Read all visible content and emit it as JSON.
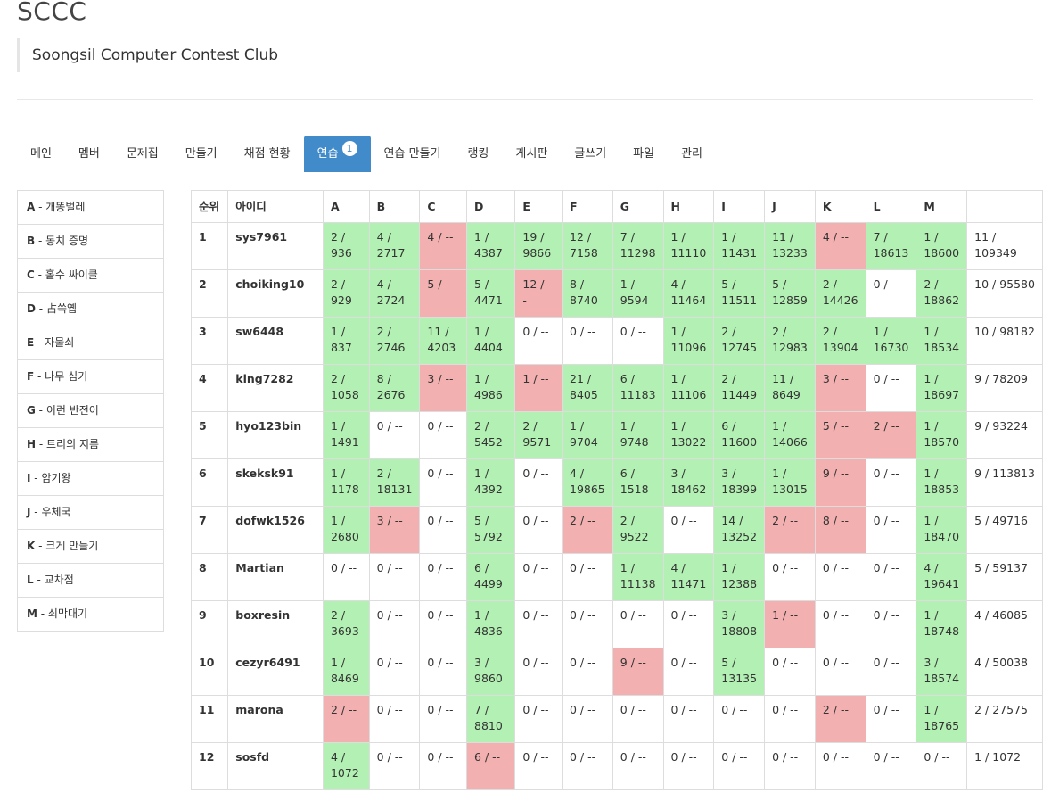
{
  "site": {
    "title": "SCCC",
    "subtitle": "Soongsil Computer Contest Club"
  },
  "nav": {
    "items": [
      "메인",
      "멤버",
      "문제집",
      "만들기",
      "채점 현황",
      "연습",
      "연습 만들기",
      "랭킹",
      "게시판",
      "글쓰기",
      "파일",
      "관리"
    ],
    "active_index": 5,
    "badge": "1"
  },
  "problems": [
    {
      "code": "A",
      "name": "개똥벌레"
    },
    {
      "code": "B",
      "name": "동치 증명"
    },
    {
      "code": "C",
      "name": "홀수 싸이클"
    },
    {
      "code": "D",
      "name": "占쏙옙"
    },
    {
      "code": "E",
      "name": "자물쇠"
    },
    {
      "code": "F",
      "name": "나무 심기"
    },
    {
      "code": "G",
      "name": "이런 반전이"
    },
    {
      "code": "H",
      "name": "트리의 지름"
    },
    {
      "code": "I",
      "name": "암기왕"
    },
    {
      "code": "J",
      "name": "우체국"
    },
    {
      "code": "K",
      "name": "크게 만들기"
    },
    {
      "code": "L",
      "name": "교차점"
    },
    {
      "code": "M",
      "name": "쇠막대기"
    }
  ],
  "table": {
    "headers": {
      "rank": "순위",
      "id": "아이디",
      "total": ""
    },
    "rows": [
      {
        "rank": "1",
        "id": "sys7961",
        "total": "11 / 109349",
        "cells": [
          {
            "t": "2 / 936",
            "s": "ok"
          },
          {
            "t": "4 / 2717",
            "s": "ok"
          },
          {
            "t": "4 / --",
            "s": "bad"
          },
          {
            "t": "1 / 4387",
            "s": "ok"
          },
          {
            "t": "19 / 9866",
            "s": "ok"
          },
          {
            "t": "12 / 7158",
            "s": "ok"
          },
          {
            "t": "7 / 11298",
            "s": "ok"
          },
          {
            "t": "1 / 11110",
            "s": "ok"
          },
          {
            "t": "1 / 11431",
            "s": "ok"
          },
          {
            "t": "11 / 13233",
            "s": "ok"
          },
          {
            "t": "4 / --",
            "s": "bad"
          },
          {
            "t": "7 / 18613",
            "s": "ok"
          },
          {
            "t": "1 / 18600",
            "s": "ok"
          }
        ]
      },
      {
        "rank": "2",
        "id": "choiking10",
        "total": "10 / 95580",
        "cells": [
          {
            "t": "2 / 929",
            "s": "ok"
          },
          {
            "t": "4 / 2724",
            "s": "ok"
          },
          {
            "t": "5 / --",
            "s": "bad"
          },
          {
            "t": "5 / 4471",
            "s": "ok"
          },
          {
            "t": "12 / --",
            "s": "bad"
          },
          {
            "t": "8 / 8740",
            "s": "ok"
          },
          {
            "t": "1 / 9594",
            "s": "ok"
          },
          {
            "t": "4 / 11464",
            "s": "ok"
          },
          {
            "t": "5 / 11511",
            "s": "ok"
          },
          {
            "t": "5 / 12859",
            "s": "ok"
          },
          {
            "t": "2 / 14426",
            "s": "ok"
          },
          {
            "t": "0 / --",
            "s": "none"
          },
          {
            "t": "2 / 18862",
            "s": "ok"
          }
        ]
      },
      {
        "rank": "3",
        "id": "sw6448",
        "total": "10 / 98182",
        "cells": [
          {
            "t": "1 / 837",
            "s": "ok"
          },
          {
            "t": "2 / 2746",
            "s": "ok"
          },
          {
            "t": "11 / 4203",
            "s": "ok"
          },
          {
            "t": "1 / 4404",
            "s": "ok"
          },
          {
            "t": "0 / --",
            "s": "none"
          },
          {
            "t": "0 / --",
            "s": "none"
          },
          {
            "t": "0 / --",
            "s": "none"
          },
          {
            "t": "1 / 11096",
            "s": "ok"
          },
          {
            "t": "2 / 12745",
            "s": "ok"
          },
          {
            "t": "2 / 12983",
            "s": "ok"
          },
          {
            "t": "2 / 13904",
            "s": "ok"
          },
          {
            "t": "1 / 16730",
            "s": "ok"
          },
          {
            "t": "1 / 18534",
            "s": "ok"
          }
        ]
      },
      {
        "rank": "4",
        "id": "king7282",
        "total": "9 / 78209",
        "cells": [
          {
            "t": "2 / 1058",
            "s": "ok"
          },
          {
            "t": "8 / 2676",
            "s": "ok"
          },
          {
            "t": "3 / --",
            "s": "bad"
          },
          {
            "t": "1 / 4986",
            "s": "ok"
          },
          {
            "t": "1 / --",
            "s": "bad"
          },
          {
            "t": "21 / 8405",
            "s": "ok"
          },
          {
            "t": "6 / 11183",
            "s": "ok"
          },
          {
            "t": "1 / 11106",
            "s": "ok"
          },
          {
            "t": "2 / 11449",
            "s": "ok"
          },
          {
            "t": "11 / 8649",
            "s": "ok"
          },
          {
            "t": "3 / --",
            "s": "bad"
          },
          {
            "t": "0 / --",
            "s": "none"
          },
          {
            "t": "1 / 18697",
            "s": "ok"
          }
        ]
      },
      {
        "rank": "5",
        "id": "hyo123bin",
        "total": "9 / 93224",
        "cells": [
          {
            "t": "1 / 1491",
            "s": "ok"
          },
          {
            "t": "0 / --",
            "s": "none"
          },
          {
            "t": "0 / --",
            "s": "none"
          },
          {
            "t": "2 / 5452",
            "s": "ok"
          },
          {
            "t": "2 / 9571",
            "s": "ok"
          },
          {
            "t": "1 / 9704",
            "s": "ok"
          },
          {
            "t": "1 / 9748",
            "s": "ok"
          },
          {
            "t": "1 / 13022",
            "s": "ok"
          },
          {
            "t": "6 / 11600",
            "s": "ok"
          },
          {
            "t": "1 / 14066",
            "s": "ok"
          },
          {
            "t": "5 / --",
            "s": "bad"
          },
          {
            "t": "2 / --",
            "s": "bad"
          },
          {
            "t": "1 / 18570",
            "s": "ok"
          }
        ]
      },
      {
        "rank": "6",
        "id": "skeksk91",
        "total": "9 / 113813",
        "cells": [
          {
            "t": "1 / 1178",
            "s": "ok"
          },
          {
            "t": "2 / 18131",
            "s": "ok"
          },
          {
            "t": "0 / --",
            "s": "none"
          },
          {
            "t": "1 / 4392",
            "s": "ok"
          },
          {
            "t": "0 / --",
            "s": "none"
          },
          {
            "t": "4 / 19865",
            "s": "ok"
          },
          {
            "t": "6 / 1518",
            "s": "ok"
          },
          {
            "t": "3 / 18462",
            "s": "ok"
          },
          {
            "t": "3 / 18399",
            "s": "ok"
          },
          {
            "t": "1 / 13015",
            "s": "ok"
          },
          {
            "t": "9 / --",
            "s": "bad"
          },
          {
            "t": "0 / --",
            "s": "none"
          },
          {
            "t": "1 / 18853",
            "s": "ok"
          }
        ]
      },
      {
        "rank": "7",
        "id": "dofwk1526",
        "total": "5 / 49716",
        "cells": [
          {
            "t": "1 / 2680",
            "s": "ok"
          },
          {
            "t": "3 / --",
            "s": "bad"
          },
          {
            "t": "0 / --",
            "s": "none"
          },
          {
            "t": "5 / 5792",
            "s": "ok"
          },
          {
            "t": "0 / --",
            "s": "none"
          },
          {
            "t": "2 / --",
            "s": "bad"
          },
          {
            "t": "2 / 9522",
            "s": "ok"
          },
          {
            "t": "0 / --",
            "s": "none"
          },
          {
            "t": "14 / 13252",
            "s": "ok"
          },
          {
            "t": "2 / --",
            "s": "bad"
          },
          {
            "t": "8 / --",
            "s": "bad"
          },
          {
            "t": "0 / --",
            "s": "none"
          },
          {
            "t": "1 / 18470",
            "s": "ok"
          }
        ]
      },
      {
        "rank": "8",
        "id": "Martian",
        "total": "5 / 59137",
        "cells": [
          {
            "t": "0 / --",
            "s": "none"
          },
          {
            "t": "0 / --",
            "s": "none"
          },
          {
            "t": "0 / --",
            "s": "none"
          },
          {
            "t": "6 / 4499",
            "s": "ok"
          },
          {
            "t": "0 / --",
            "s": "none"
          },
          {
            "t": "0 / --",
            "s": "none"
          },
          {
            "t": "1 / 11138",
            "s": "ok"
          },
          {
            "t": "4 / 11471",
            "s": "ok"
          },
          {
            "t": "1 / 12388",
            "s": "ok"
          },
          {
            "t": "0 / --",
            "s": "none"
          },
          {
            "t": "0 / --",
            "s": "none"
          },
          {
            "t": "0 / --",
            "s": "none"
          },
          {
            "t": "4 / 19641",
            "s": "ok"
          }
        ]
      },
      {
        "rank": "9",
        "id": "boxresin",
        "total": "4 / 46085",
        "cells": [
          {
            "t": "2 / 3693",
            "s": "ok"
          },
          {
            "t": "0 / --",
            "s": "none"
          },
          {
            "t": "0 / --",
            "s": "none"
          },
          {
            "t": "1 / 4836",
            "s": "ok"
          },
          {
            "t": "0 / --",
            "s": "none"
          },
          {
            "t": "0 / --",
            "s": "none"
          },
          {
            "t": "0 / --",
            "s": "none"
          },
          {
            "t": "0 / --",
            "s": "none"
          },
          {
            "t": "3 / 18808",
            "s": "ok"
          },
          {
            "t": "1 / --",
            "s": "bad"
          },
          {
            "t": "0 / --",
            "s": "none"
          },
          {
            "t": "0 / --",
            "s": "none"
          },
          {
            "t": "1 / 18748",
            "s": "ok"
          }
        ]
      },
      {
        "rank": "10",
        "id": "cezyr6491",
        "total": "4 / 50038",
        "cells": [
          {
            "t": "1 / 8469",
            "s": "ok"
          },
          {
            "t": "0 / --",
            "s": "none"
          },
          {
            "t": "0 / --",
            "s": "none"
          },
          {
            "t": "3 / 9860",
            "s": "ok"
          },
          {
            "t": "0 / --",
            "s": "none"
          },
          {
            "t": "0 / --",
            "s": "none"
          },
          {
            "t": "9 / --",
            "s": "bad"
          },
          {
            "t": "0 / --",
            "s": "none"
          },
          {
            "t": "5 / 13135",
            "s": "ok"
          },
          {
            "t": "0 / --",
            "s": "none"
          },
          {
            "t": "0 / --",
            "s": "none"
          },
          {
            "t": "0 / --",
            "s": "none"
          },
          {
            "t": "3 / 18574",
            "s": "ok"
          }
        ]
      },
      {
        "rank": "11",
        "id": "marona",
        "total": "2 / 27575",
        "cells": [
          {
            "t": "2 / --",
            "s": "bad"
          },
          {
            "t": "0 / --",
            "s": "none"
          },
          {
            "t": "0 / --",
            "s": "none"
          },
          {
            "t": "7 / 8810",
            "s": "ok"
          },
          {
            "t": "0 / --",
            "s": "none"
          },
          {
            "t": "0 / --",
            "s": "none"
          },
          {
            "t": "0 / --",
            "s": "none"
          },
          {
            "t": "0 / --",
            "s": "none"
          },
          {
            "t": "0 / --",
            "s": "none"
          },
          {
            "t": "0 / --",
            "s": "none"
          },
          {
            "t": "2 / --",
            "s": "bad"
          },
          {
            "t": "0 / --",
            "s": "none"
          },
          {
            "t": "1 / 18765",
            "s": "ok"
          }
        ]
      },
      {
        "rank": "12",
        "id": "sosfd",
        "total": "1 / 1072",
        "cells": [
          {
            "t": "4 / 1072",
            "s": "ok"
          },
          {
            "t": "0 / --",
            "s": "none"
          },
          {
            "t": "0 / --",
            "s": "none"
          },
          {
            "t": "6 / --",
            "s": "bad"
          },
          {
            "t": "0 / --",
            "s": "none"
          },
          {
            "t": "0 / --",
            "s": "none"
          },
          {
            "t": "0 / --",
            "s": "none"
          },
          {
            "t": "0 / --",
            "s": "none"
          },
          {
            "t": "0 / --",
            "s": "none"
          },
          {
            "t": "0 / --",
            "s": "none"
          },
          {
            "t": "0 / --",
            "s": "none"
          },
          {
            "t": "0 / --",
            "s": "none"
          },
          {
            "t": "0 / --",
            "s": "none"
          }
        ]
      }
    ]
  },
  "colors": {
    "accepted": "#b3f0b3",
    "wrong": "#f2b0b0",
    "nav_active": "#428bca"
  }
}
